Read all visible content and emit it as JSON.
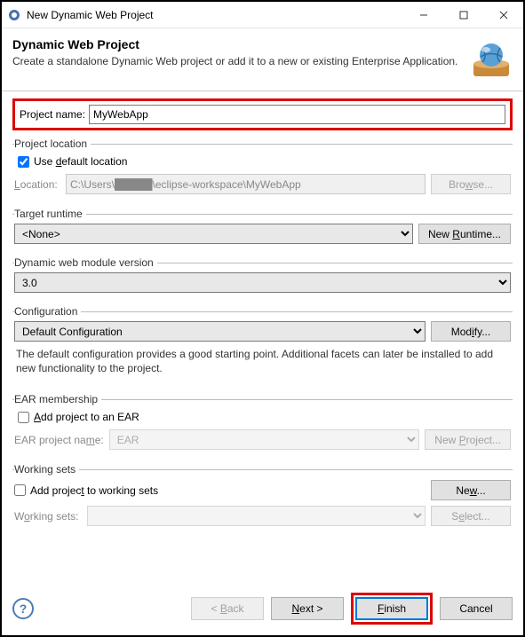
{
  "window": {
    "title": "New Dynamic Web Project"
  },
  "header": {
    "title": "Dynamic Web Project",
    "subtitle": "Create a standalone Dynamic Web project or add it to a new or existing Enterprise Application."
  },
  "project_name": {
    "label": "Project name:",
    "value": "MyWebApp"
  },
  "location": {
    "legend": "Project location",
    "use_default_label": "Use default location",
    "use_default_checked": true,
    "label": "Location:",
    "value": "C:\\Users\\█████\\eclipse-workspace\\MyWebApp",
    "browse": "Browse..."
  },
  "runtime": {
    "legend": "Target runtime",
    "value": "<None>",
    "new_runtime": "New Runtime..."
  },
  "module_version": {
    "legend": "Dynamic web module version",
    "value": "3.0"
  },
  "configuration": {
    "legend": "Configuration",
    "value": "Default Configuration",
    "modify": "Modify...",
    "description": "The default configuration provides a good starting point. Additional facets can later be installed to add new functionality to the project."
  },
  "ear": {
    "legend": "EAR membership",
    "add_label": "Add project to an EAR",
    "add_checked": false,
    "project_label": "EAR project name:",
    "project_value": "EAR",
    "new_project": "New Project..."
  },
  "working_sets": {
    "legend": "Working sets",
    "add_label": "Add project to working sets",
    "add_checked": false,
    "label": "Working sets:",
    "value": "",
    "new": "New...",
    "select": "Select..."
  },
  "footer": {
    "back": "< Back",
    "next": "Next >",
    "finish": "Finish",
    "cancel": "Cancel"
  }
}
